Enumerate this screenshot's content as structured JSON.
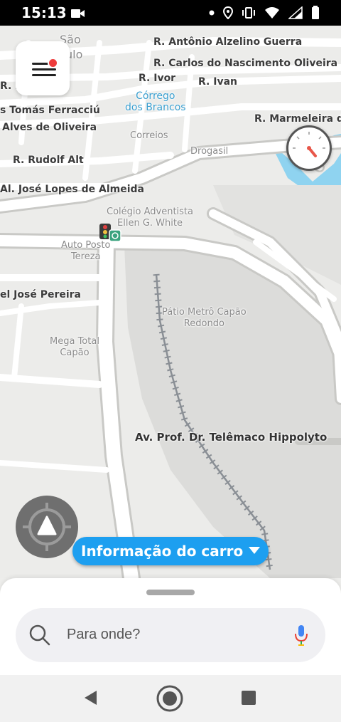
{
  "status_bar": {
    "time": "15:13",
    "icons": [
      "video-camera-icon",
      "notification-dot-icon",
      "location-icon",
      "vibrate-icon",
      "wifi-icon",
      "battery-icon"
    ]
  },
  "map": {
    "streets": [
      {
        "id": "s1",
        "text": "R. Antônio Alzelino Guerra"
      },
      {
        "id": "s2",
        "text": "R. Carlos do Nascimento Oliveira"
      },
      {
        "id": "s3",
        "text": "R. Ivor"
      },
      {
        "id": "s4",
        "text": "R. Ivan"
      },
      {
        "id": "s5",
        "text": "R. F...ra"
      },
      {
        "id": "s6",
        "text": "s Tomás Ferracciú"
      },
      {
        "id": "s7",
        "text": "Alves de Oliveira"
      },
      {
        "id": "s8",
        "text": "R. Marmeleira da"
      },
      {
        "id": "s9",
        "text": "R. Rudolf Alt"
      },
      {
        "id": "s10",
        "text": "Al. José Lopes de Almeida"
      },
      {
        "id": "s11",
        "text": "el José Pereira"
      },
      {
        "id": "s12",
        "text": "Av. Prof. Dr. Telêmaco Hippolyto"
      }
    ],
    "places": [
      {
        "id": "p1",
        "text": "São"
      },
      {
        "id": "p2",
        "text": "ulo"
      },
      {
        "id": "p3",
        "text": "Correios"
      },
      {
        "id": "p4",
        "text": "Drogasil"
      },
      {
        "id": "p5",
        "text": "Colégio Adventista\nEllen G. White"
      },
      {
        "id": "p6",
        "text": "Auto Posto\nTereza"
      },
      {
        "id": "p7",
        "text": "Pátio Metrô Capão\nRedondo"
      },
      {
        "id": "p8",
        "text": "Mega Total\nCapão"
      }
    ],
    "water": [
      {
        "id": "w1",
        "text": "Córrego\ndos Brancos"
      }
    ],
    "colors": {
      "water": "#8fd3f0",
      "road": "#ffffff",
      "road_edge": "#c9c9c6",
      "rail": "#8a8f95",
      "background": "#ececea"
    }
  },
  "menu_button": {
    "icon": "hamburger-menu-icon",
    "badge_color": "#ee3c3c"
  },
  "speedometer": {
    "icon": "speedometer-icon"
  },
  "recenter_button": {
    "icon": "recenter-arrow-icon"
  },
  "car_info": {
    "label": "Informação do carro",
    "icon": "caret-down-icon",
    "color": "#1d9ff0"
  },
  "search": {
    "placeholder": "Para onde?",
    "left_icon": "search-icon",
    "right_icon": "microphone-icon"
  },
  "nav_bar": {
    "back": "back-triangle-icon",
    "home": "home-circle-icon",
    "recents": "recents-square-icon"
  }
}
